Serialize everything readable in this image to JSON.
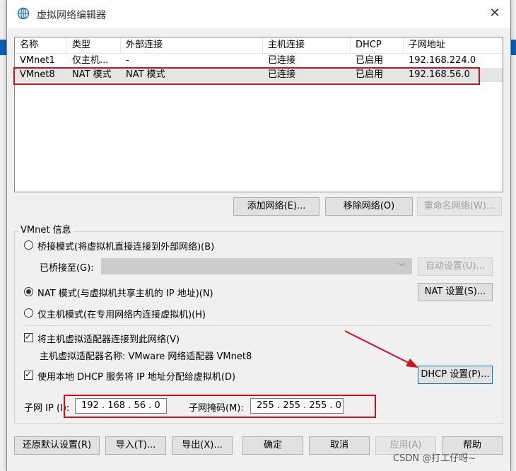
{
  "window": {
    "title": "虚拟网络编辑器",
    "close": "✕"
  },
  "table": {
    "headers": [
      "名称",
      "类型",
      "外部连接",
      "主机连接",
      "DHCP",
      "子网地址"
    ],
    "rows": [
      [
        "VMnet1",
        "仅主机...",
        "-",
        "已连接",
        "已启用",
        "192.168.224.0"
      ],
      [
        "VMnet8",
        "NAT 模式",
        "NAT 模式",
        "已连接",
        "已启用",
        "192.168.56.0"
      ]
    ]
  },
  "table_buttons": {
    "add": "添加网络(E)...",
    "remove": "移除网络(O)",
    "rename": "重命名网络(W)..."
  },
  "vmnet": {
    "group_label": "VMnet 信息",
    "bridge_mode": "桥接模式(将虚拟机直接连接到外部网络)(B)",
    "bridged_to": "已桥接至(G):",
    "auto_settings": "自动设置(U)...",
    "nat_mode": "NAT 模式(与虚拟机共享主机的 IP 地址)(N)",
    "nat_settings": "NAT 设置(S)...",
    "host_only": "仅主机模式(在专用网络内连接虚拟机)(H)",
    "connect_adapter": "将主机虚拟适配器连接到此网络(V)",
    "adapter_name": "主机虚拟适配器名称: VMware 网络适配器 VMnet8",
    "use_dhcp": "使用本地 DHCP 服务将 IP 地址分配给虚拟机(D)",
    "dhcp_settings": "DHCP 设置(P)...",
    "subnet_ip_label": "子网 IP (I):",
    "subnet_ip": "192 . 168 . 56  .  0",
    "mask_label": "子网掩码(M):",
    "mask": "255 . 255 . 255 .  0"
  },
  "footer": {
    "restore": "还原默认设置(R)",
    "import": "导入(T)...",
    "export": "导出(X)...",
    "ok": "确定",
    "cancel": "取消",
    "apply": "应用(A)",
    "help": "帮助"
  },
  "watermark": "CSDN @打工仔呀~",
  "colors": {
    "annotation": "#d2101b",
    "accent": "#0078d7"
  }
}
